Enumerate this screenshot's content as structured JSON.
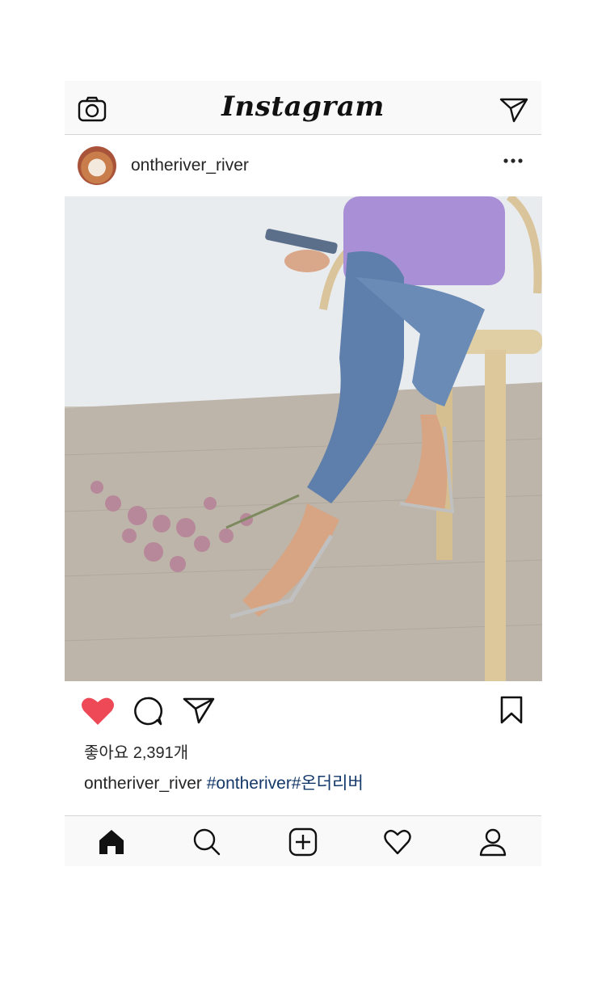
{
  "topbar": {
    "logo": "Instagram",
    "left_icon": "camera-icon",
    "right_icon": "send-icon"
  },
  "post": {
    "username": "ontheriver_river",
    "avatar_icon": "avatar",
    "more_icon": "more-options-icon",
    "photo_alt": "photo",
    "liked": true,
    "like_color": "#ed4956",
    "likes_text": "좋아요 2,391개",
    "caption_user": "ontheriver_river",
    "caption_tags": "#ontheriver#온더리버",
    "tag_color": "#14396a"
  },
  "actions": [
    "heart-icon",
    "comment-icon",
    "share-icon",
    "bookmark-icon"
  ],
  "navbar": [
    "home-icon",
    "search-icon",
    "add-post-icon",
    "activity-heart-icon",
    "profile-icon"
  ]
}
